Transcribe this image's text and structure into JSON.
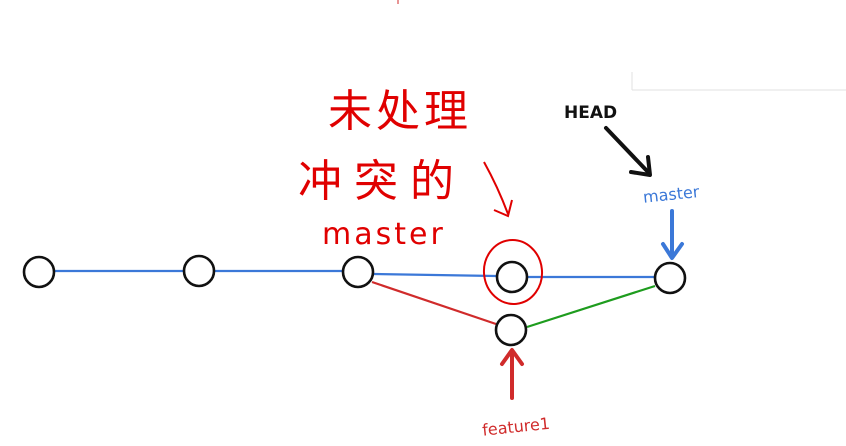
{
  "diagram": {
    "labels": {
      "head": "HEAD",
      "master_branch": "master",
      "feature_branch": "feature1"
    },
    "annotation": {
      "line1": "未处理",
      "line2": "冲突的",
      "line3": "master"
    },
    "commits": [
      {
        "id": "c1",
        "branch": "master"
      },
      {
        "id": "c2",
        "branch": "master"
      },
      {
        "id": "c3",
        "branch": "master"
      },
      {
        "id": "c4",
        "branch": "master"
      },
      {
        "id": "c5",
        "branch": "master"
      },
      {
        "id": "c6",
        "branch": "feature1"
      }
    ],
    "edges": [
      {
        "from": "c1",
        "to": "c2",
        "branch": "master"
      },
      {
        "from": "c2",
        "to": "c3",
        "branch": "master"
      },
      {
        "from": "c3",
        "to": "c4",
        "branch": "master"
      },
      {
        "from": "c4",
        "to": "c5",
        "branch": "master"
      },
      {
        "from": "c3",
        "to": "c6",
        "branch": "feature1"
      },
      {
        "from": "c6",
        "to": "c5",
        "branch": "merge"
      }
    ],
    "colors": {
      "master_line": "#3b78d8",
      "feature_line": "#d02b2b",
      "merge_line": "#1e9c1e",
      "head_arrow": "#111111",
      "master_label": "#3b78d8",
      "feature_label": "#d02b2b",
      "annotation": "#e00000",
      "commit_stroke": "#111111"
    }
  }
}
